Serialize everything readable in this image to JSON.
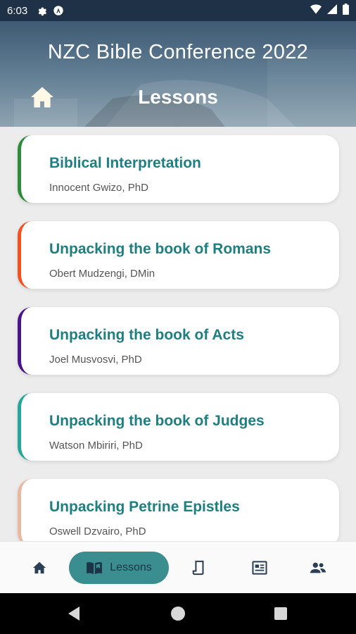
{
  "status_bar": {
    "time": "6:03",
    "icons_left": [
      "gear-icon",
      "app-notification-icon"
    ],
    "icons_right": [
      "wifi-icon",
      "signal-icon",
      "battery-icon"
    ]
  },
  "header": {
    "title": "NZC Bible Conference 2022",
    "subtitle": "Lessons",
    "home_icon": "home-icon"
  },
  "lessons": [
    {
      "title": "Biblical Interpretation",
      "author": "Innocent Gwizo, PhD",
      "accent": "#2e8b3a"
    },
    {
      "title": "Unpacking the book of Romans",
      "author": "Obert Mudzengi, DMin",
      "accent": "#f4511e"
    },
    {
      "title": "Unpacking the book of Acts",
      "author": "Joel Musvosvi, PhD",
      "accent": "#4a148c"
    },
    {
      "title": "Unpacking the book of Judges",
      "author": "Watson Mbiriri, PhD",
      "accent": "#26a69a"
    },
    {
      "title": "Unpacking Petrine Epistles",
      "author": "Oswell Dzvairo, PhD",
      "accent": "#e8b9a0"
    }
  ],
  "bottom_nav": {
    "items": [
      {
        "icon": "home-icon"
      },
      {
        "icon": "book-icon",
        "label": "Lessons",
        "active": true
      },
      {
        "icon": "scroll-icon"
      },
      {
        "icon": "newspaper-icon"
      },
      {
        "icon": "people-icon"
      }
    ]
  },
  "colors": {
    "accent": "#3a8e8f",
    "title_text": "#1f7f80",
    "status_bar": "#1e3147"
  }
}
